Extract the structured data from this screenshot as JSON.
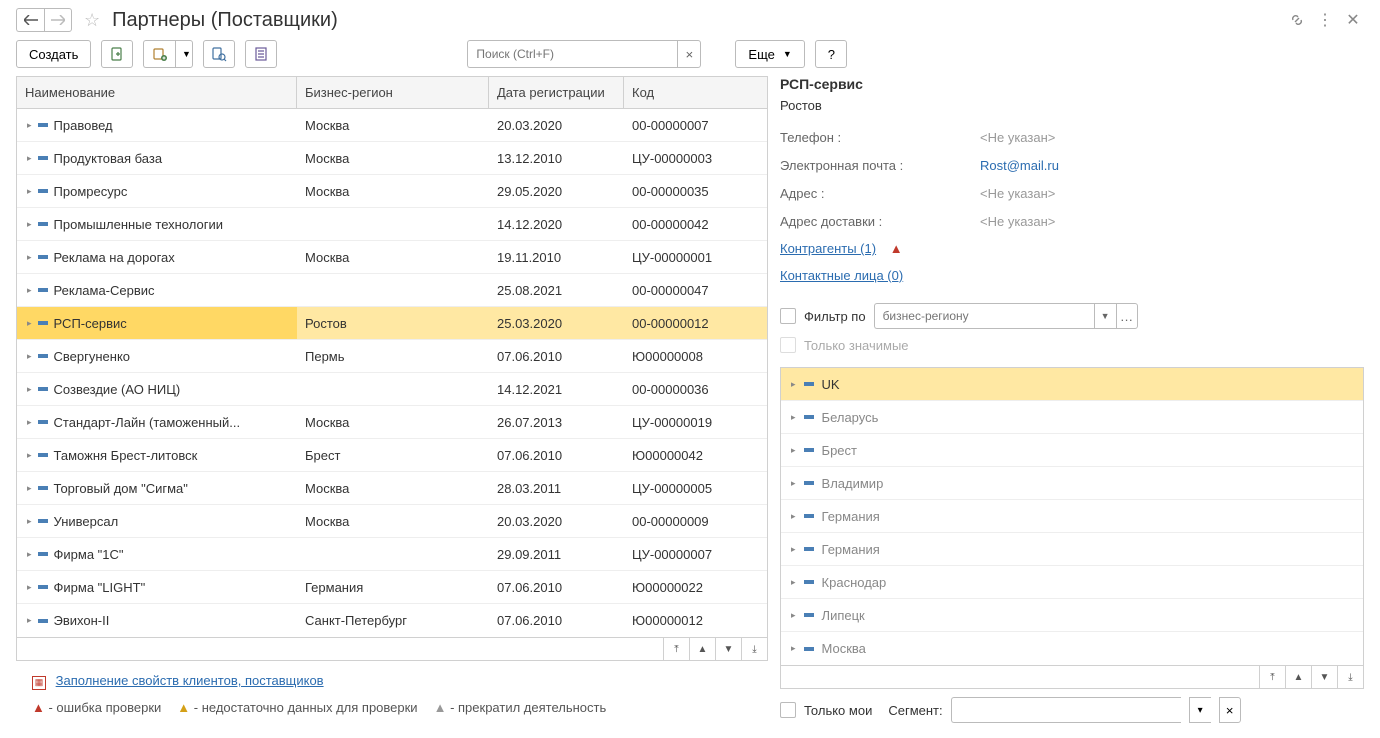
{
  "header": {
    "title": "Партнеры (Поставщики)"
  },
  "toolbar": {
    "create_label": "Создать",
    "more_label": "Еще",
    "help_label": "?",
    "search_placeholder": "Поиск (Ctrl+F)"
  },
  "table": {
    "columns": {
      "name": "Наименование",
      "region": "Бизнес-регион",
      "date": "Дата регистрации",
      "code": "Код"
    },
    "rows": [
      {
        "name": "Правовед",
        "region": "Москва",
        "date": "20.03.2020",
        "code": "00-00000007",
        "selected": false
      },
      {
        "name": "Продуктовая база",
        "region": "Москва",
        "date": "13.12.2010",
        "code": "ЦУ-00000003",
        "selected": false
      },
      {
        "name": "Промресурс",
        "region": "Москва",
        "date": "29.05.2020",
        "code": "00-00000035",
        "selected": false
      },
      {
        "name": "Промышленные технологии",
        "region": "",
        "date": "14.12.2020",
        "code": "00-00000042",
        "selected": false
      },
      {
        "name": "Реклама на дорогах",
        "region": "Москва",
        "date": "19.11.2010",
        "code": "ЦУ-00000001",
        "selected": false
      },
      {
        "name": "Реклама-Сервис",
        "region": "",
        "date": "25.08.2021",
        "code": "00-00000047",
        "selected": false
      },
      {
        "name": "РСП-сервис",
        "region": "Ростов",
        "date": "25.03.2020",
        "code": "00-00000012",
        "selected": true
      },
      {
        "name": "Свергуненко",
        "region": "Пермь",
        "date": "07.06.2010",
        "code": "Ю00000008",
        "selected": false
      },
      {
        "name": "Созвездие (АО НИЦ)",
        "region": "",
        "date": "14.12.2021",
        "code": "00-00000036",
        "selected": false
      },
      {
        "name": "Стандарт-Лайн (таможенный...",
        "region": "Москва",
        "date": "26.07.2013",
        "code": "ЦУ-00000019",
        "selected": false
      },
      {
        "name": "Таможня Брест-литовск",
        "region": "Брест",
        "date": "07.06.2010",
        "code": "Ю00000042",
        "selected": false
      },
      {
        "name": "Торговый дом \"Сигма\"",
        "region": "Москва",
        "date": "28.03.2011",
        "code": "ЦУ-00000005",
        "selected": false
      },
      {
        "name": "Универсал",
        "region": "Москва",
        "date": "20.03.2020",
        "code": "00-00000009",
        "selected": false
      },
      {
        "name": "Фирма \"1С\"",
        "region": "",
        "date": "29.09.2011",
        "code": "ЦУ-00000007",
        "selected": false
      },
      {
        "name": "Фирма \"LIGHT\"",
        "region": "Германия",
        "date": "07.06.2010",
        "code": "Ю00000022",
        "selected": false
      },
      {
        "name": "Эвихон-II",
        "region": "Санкт-Петербург",
        "date": "07.06.2010",
        "code": "Ю00000012",
        "selected": false
      }
    ]
  },
  "detail": {
    "title": "РСП-сервис",
    "city": "Ростов",
    "phone_label": "Телефон :",
    "phone_value": "<Не указан>",
    "email_label": "Электронная почта :",
    "email_value": "Rost@mail.ru",
    "address_label": "Адрес :",
    "address_value": "<Не указан>",
    "delivery_label": "Адрес доставки :",
    "delivery_value": "<Не указан>",
    "counterparties_link": "Контрагенты (1)",
    "contacts_link": "Контактные лица (0)",
    "filter_label": "Фильтр по",
    "filter_placeholder": "бизнес-региону",
    "only_significant": "Только значимые",
    "regions": [
      {
        "name": "UK",
        "selected": true
      },
      {
        "name": "Беларусь",
        "selected": false
      },
      {
        "name": "Брест",
        "selected": false
      },
      {
        "name": "Владимир",
        "selected": false
      },
      {
        "name": "Германия",
        "selected": false
      },
      {
        "name": "Германия",
        "selected": false
      },
      {
        "name": "Краснодар",
        "selected": false
      },
      {
        "name": "Липецк",
        "selected": false
      },
      {
        "name": "Москва",
        "selected": false
      }
    ]
  },
  "footer": {
    "fill_props_link": "Заполнение свойств клиентов, поставщиков",
    "legend_error": " - ошибка проверки",
    "legend_warn": " - недостаточно данных для проверки",
    "legend_stop": " - прекратил деятельность",
    "only_mine": "Только мои",
    "segment_label": "Сегмент:"
  }
}
